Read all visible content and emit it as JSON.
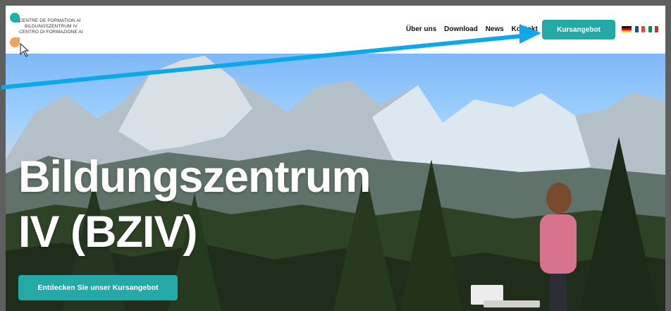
{
  "logo": {
    "lines": [
      "CENTRE DE FORMATION AI",
      "BILDUNGSZENTRUM IV",
      "CENTRO DI FORMAZIONE AI"
    ]
  },
  "nav": {
    "items": [
      "Über uns",
      "Download",
      "News",
      "Kontakt"
    ],
    "cta_label": "Kursangebot"
  },
  "languages": [
    "de-flag-icon",
    "fr-flag-icon",
    "it-flag-icon"
  ],
  "hero": {
    "title_line1": "Bildungszentrum",
    "title_line2": "IV (BZIV)",
    "button_label": "Entdecken Sie unser Kursangebot"
  },
  "colors": {
    "accent": "#23aaa6",
    "arrow": "#0ea8ea"
  }
}
